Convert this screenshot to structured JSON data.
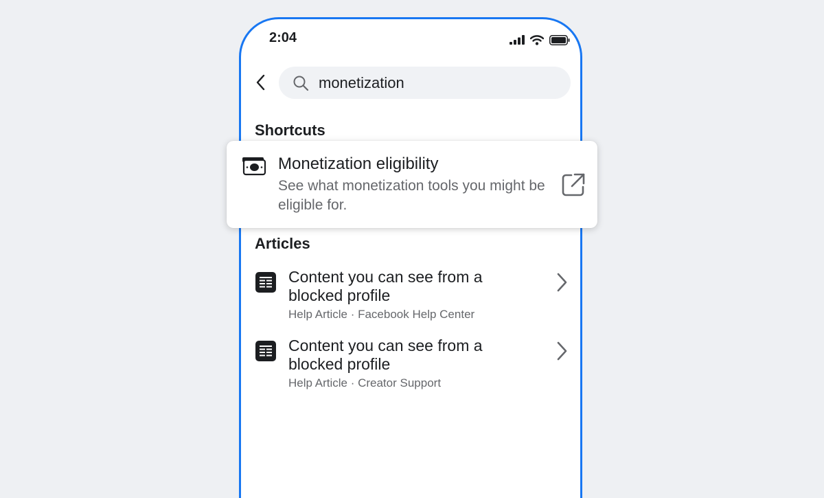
{
  "status_bar": {
    "time": "2:04",
    "icons": [
      "signal-icon",
      "wifi-icon",
      "battery-icon"
    ]
  },
  "search": {
    "value": "monetization",
    "icon": "search-icon"
  },
  "shortcuts": {
    "heading": "Shortcuts",
    "items": [
      {
        "icon": "money-icon",
        "title": "Monetization eligibility",
        "description": "See what monetization tools you might be eligible for.",
        "action_icon": "external-link-icon"
      }
    ]
  },
  "articles": {
    "heading": "Articles",
    "items": [
      {
        "icon": "article-icon",
        "title": "Content you can see from a blocked profile",
        "meta": "Help Article · Facebook Help Center"
      },
      {
        "icon": "article-icon",
        "title": "Content you can see from a blocked profile",
        "meta": "Help Article · Creator Support"
      }
    ]
  },
  "colors": {
    "frame": "#1877f2",
    "background": "#eef0f3",
    "primary_text": "#1c1e21",
    "secondary_text": "#65676b",
    "search_bg": "#f0f2f5"
  }
}
